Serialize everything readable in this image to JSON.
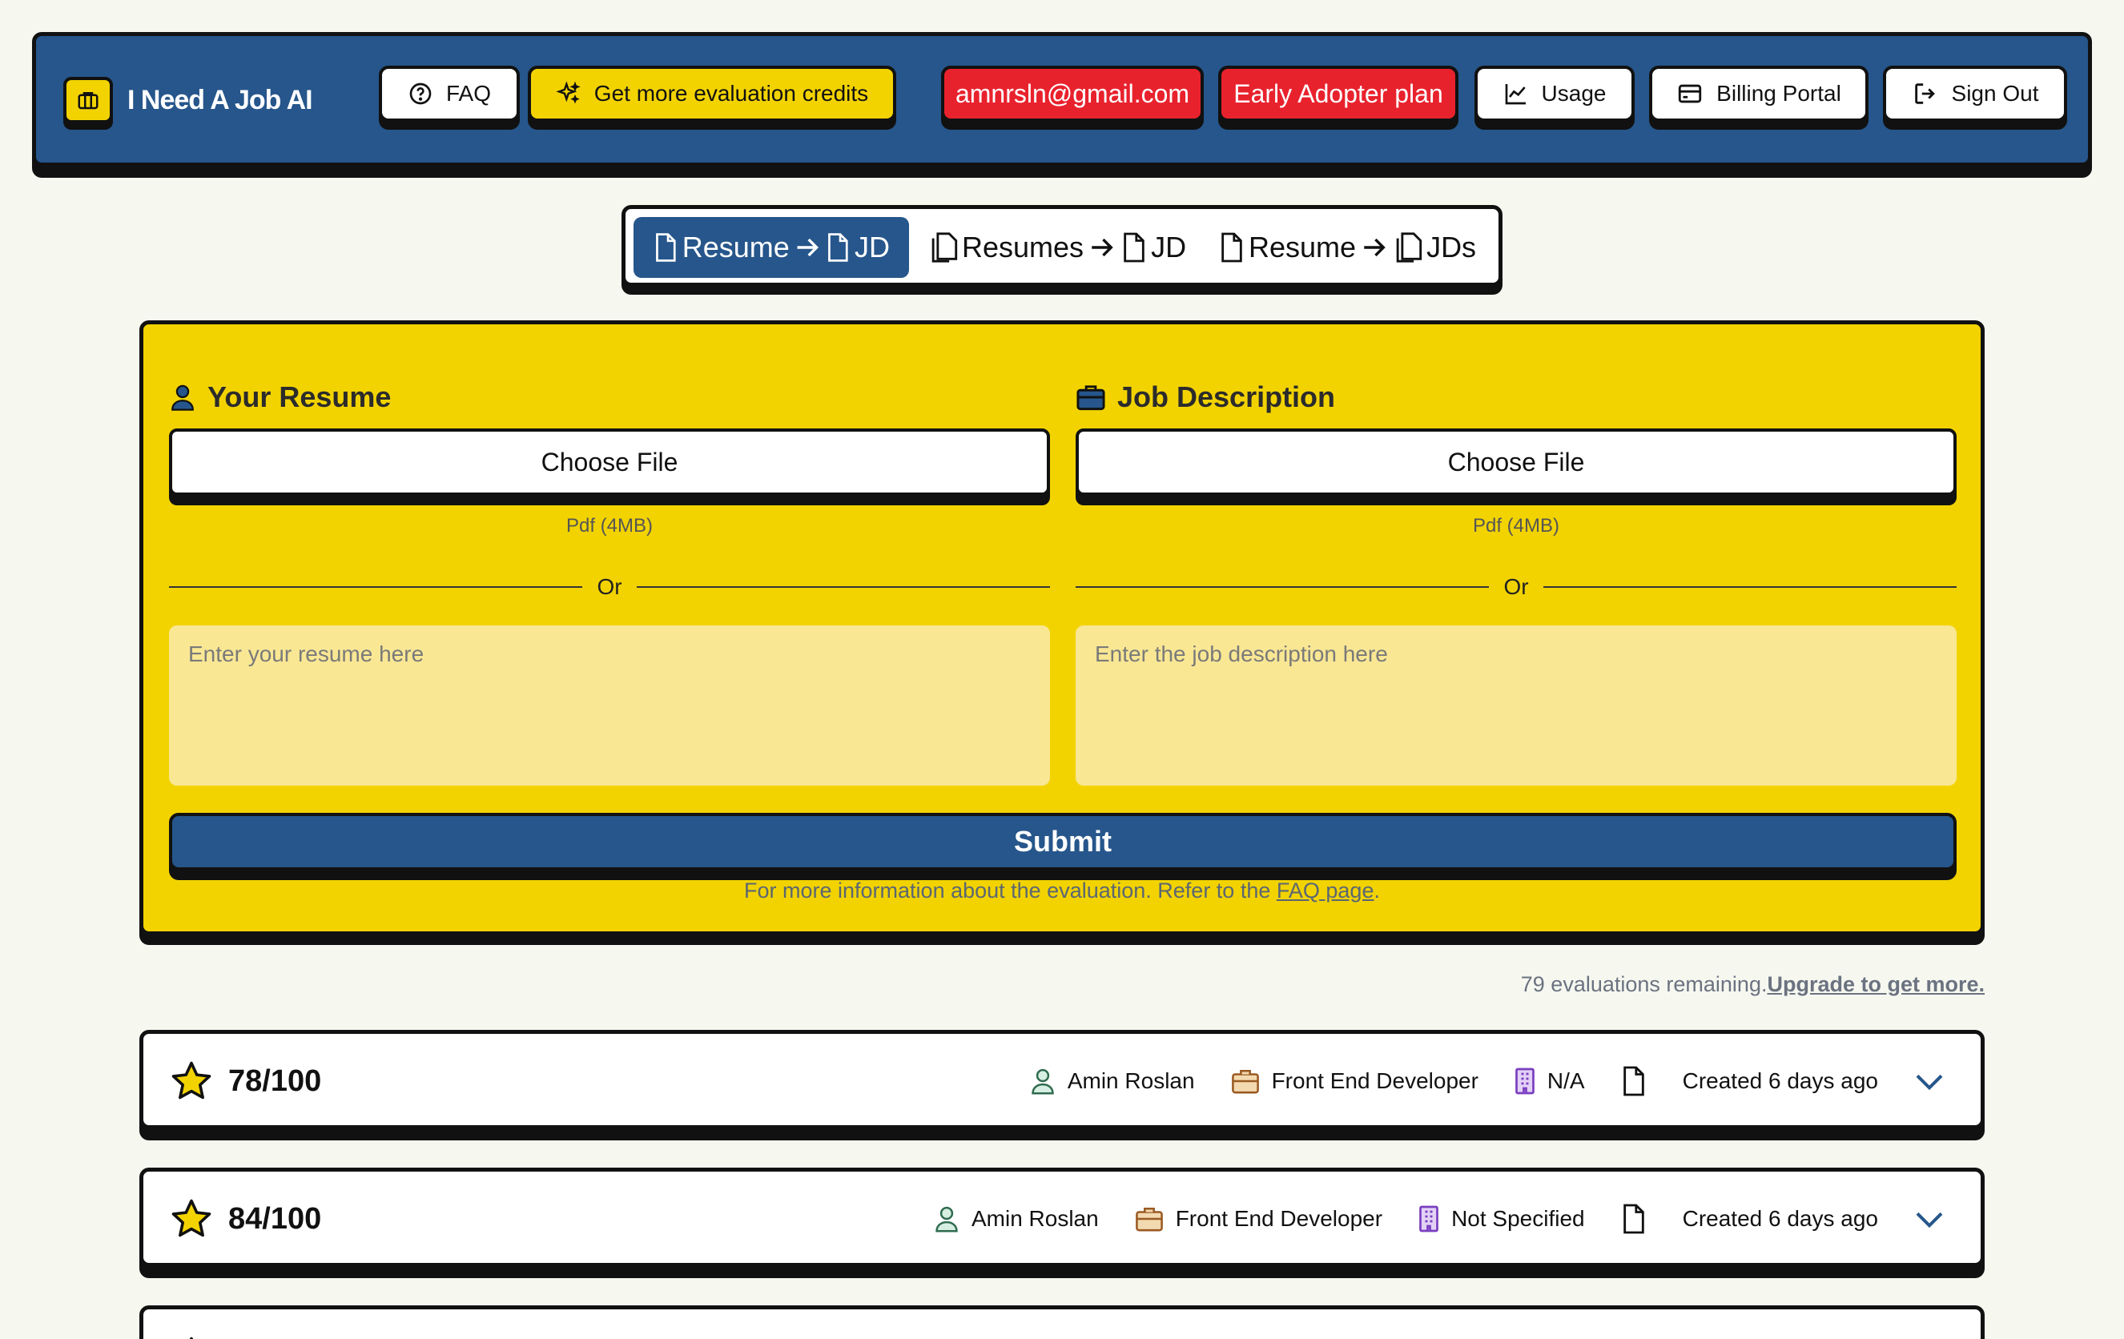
{
  "app": {
    "title": "I Need A Job AI"
  },
  "nav": {
    "faq": "FAQ",
    "credits": "Get more evaluation credits",
    "email": "amnrsln@gmail.com",
    "plan": "Early Adopter plan",
    "usage": "Usage",
    "billing": "Billing Portal",
    "signout": "Sign Out"
  },
  "tabs": [
    {
      "left": "Resume",
      "right": "JD",
      "active": true
    },
    {
      "left": "Resumes",
      "right": "JD",
      "active": false
    },
    {
      "left": "Resume",
      "right": "JDs",
      "active": false
    }
  ],
  "form": {
    "resume": {
      "title": "Your Resume",
      "file_label": "Choose File",
      "hint": "Pdf (4MB)",
      "or": "Or",
      "placeholder": "Enter your resume here"
    },
    "jd": {
      "title": "Job Description",
      "file_label": "Choose File",
      "hint": "Pdf (4MB)",
      "or": "Or",
      "placeholder": "Enter the job description here"
    },
    "submit": "Submit",
    "info_prefix": "For more information about the evaluation. Refer to the ",
    "info_link": "FAQ page",
    "info_suffix": "."
  },
  "remaining": {
    "text": "79 evaluations remaining.",
    "link": "Upgrade to get more."
  },
  "results": [
    {
      "score": "78/100",
      "name": "Amin Roslan",
      "role": "Front End Developer",
      "company": "N/A",
      "created": "Created 6 days ago"
    },
    {
      "score": "84/100",
      "name": "Amin Roslan",
      "role": "Front End Developer",
      "company": "Not Specified",
      "created": "Created 6 days ago"
    }
  ],
  "colors": {
    "primary": "#26568b",
    "accent": "#f2d300",
    "danger": "#e8222d",
    "background": "#f6f8f0"
  }
}
